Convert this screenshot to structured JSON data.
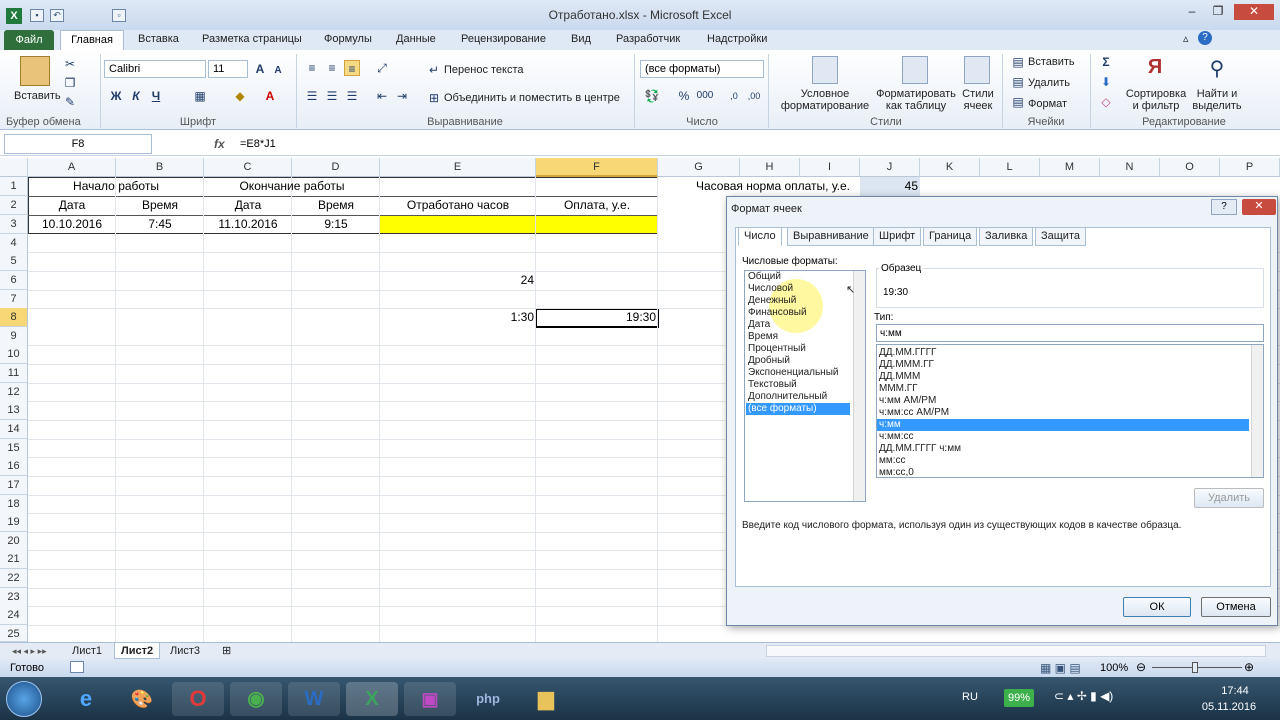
{
  "window": {
    "title": "Отработано.xlsx - Microsoft Excel"
  },
  "tabs": [
    "Файл",
    "Главная",
    "Вставка",
    "Разметка страницы",
    "Формулы",
    "Данные",
    "Рецензирование",
    "Вид",
    "Разработчик",
    "Надстройки"
  ],
  "ribbon": {
    "clipboard": {
      "paste": "Вставить",
      "label": "Буфер обмена"
    },
    "font": {
      "name": "Calibri",
      "size": "11",
      "bold": "Ж",
      "italic": "К",
      "underline": "Ч",
      "label": "Шрифт"
    },
    "alignment": {
      "wrap": "Перенос текста",
      "merge": "Объединить и поместить в центре",
      "label": "Выравнивание"
    },
    "number": {
      "format": "(все форматы)",
      "label": "Число"
    },
    "styles": {
      "conditional": "Условное форматирование",
      "as_table": "Форматировать как таблицу",
      "cell_styles": "Стили ячеек",
      "label": "Стили"
    },
    "cells": {
      "insert": "Вставить",
      "delete": "Удалить",
      "format": "Формат",
      "label": "Ячейки"
    },
    "editing": {
      "sort": "Сортировка и фильтр",
      "find": "Найти и выделить",
      "label": "Редактирование"
    }
  },
  "formula_bar": {
    "name_box": "F8",
    "fx": "fx",
    "formula": "=E8*J1"
  },
  "columns": [
    "A",
    "B",
    "C",
    "D",
    "E",
    "F",
    "G",
    "H",
    "I",
    "J",
    "K",
    "L",
    "M",
    "N",
    "O",
    "P"
  ],
  "rows": [
    "1",
    "2",
    "3",
    "4",
    "5",
    "6",
    "7",
    "8",
    "9",
    "10",
    "11",
    "12",
    "13",
    "14",
    "15",
    "16",
    "17",
    "18",
    "19",
    "20",
    "21",
    "22",
    "23",
    "24",
    "25"
  ],
  "cells": {
    "r1": {
      "ab": "Начало работы",
      "cd": "Окончание работы",
      "g": "Часовая норма оплаты, у.е.",
      "j": "45"
    },
    "r2": {
      "a": "Дата",
      "b": "Время",
      "c": "Дата",
      "d": "Время",
      "e": "Отработано часов",
      "f": "Оплата, у.е."
    },
    "r3": {
      "a": "10.10.2016",
      "b": "7:45",
      "c": "11.10.2016",
      "d": "9:15"
    },
    "r6": {
      "e": "24"
    },
    "r8": {
      "e": "1:30",
      "f": "19:30"
    }
  },
  "sheets": [
    "Лист1",
    "Лист2",
    "Лист3"
  ],
  "status": {
    "ready": "Готово",
    "zoom": "100%"
  },
  "dialog": {
    "title": "Формат ячеек",
    "tabs": [
      "Число",
      "Выравнивание",
      "Шрифт",
      "Граница",
      "Заливка",
      "Защита"
    ],
    "categories_label": "Числовые форматы:",
    "categories": [
      "Общий",
      "Числовой",
      "Денежный",
      "Финансовый",
      "Дата",
      "Время",
      "Процентный",
      "Дробный",
      "Экспоненциальный",
      "Текстовый",
      "Дополнительный",
      "(все форматы)"
    ],
    "sample_label": "Образец",
    "sample_value": "19:30",
    "type_label": "Тип:",
    "type_value": "ч:мм",
    "types": [
      "ДД.ММ.ГГГГ",
      "ДД.МММ.ГГ",
      "ДД.МММ",
      "МММ.ГГ",
      "ч:мм AM/PM",
      "ч:мм:сс AM/PM",
      "ч:мм",
      "ч:мм:сс",
      "ДД.ММ.ГГГГ ч:мм",
      "мм:сс",
      "мм:сс,0"
    ],
    "delete": "Удалить",
    "hint": "Введите код числового формата, используя один из существующих кодов в качестве образца.",
    "ok": "ОК",
    "cancel": "Отмена"
  },
  "taskbar": {
    "lang": "RU",
    "battery": "99%",
    "time": "17:44",
    "date": "05.11.2016"
  },
  "colors": {
    "yellow": "#ffff00",
    "selection": "#3399ff",
    "excel_green": "#2f6f3c"
  }
}
